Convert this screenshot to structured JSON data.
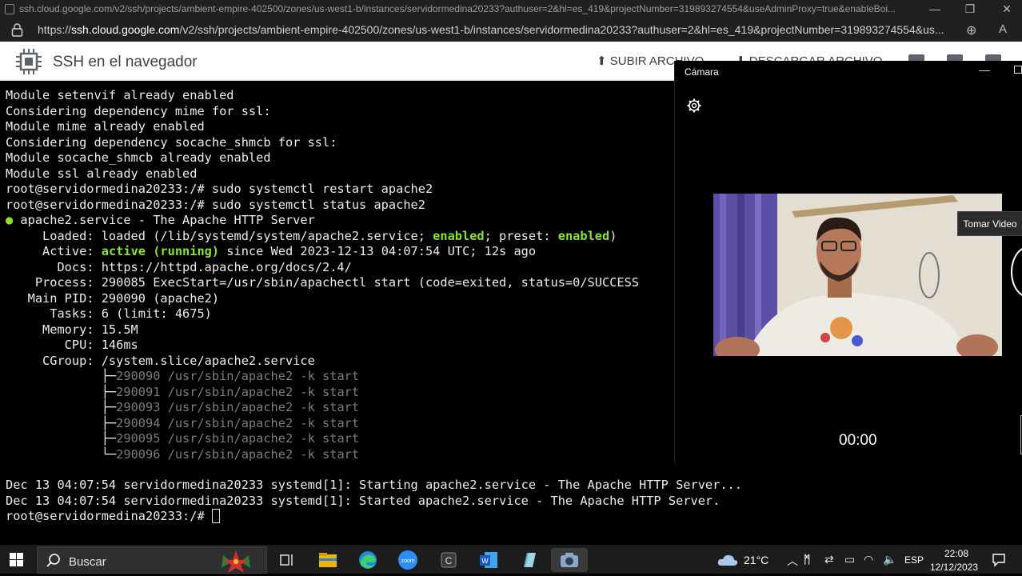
{
  "window": {
    "title": "ssh.cloud.google.com/v2/ssh/projects/ambient-empire-402500/zones/us-west1-b/instances/servidormedina20233?authuser=2&hl=es_419&projectNumber=319893274554&useAdminProxy=true&enableBoi...",
    "minimize": "—",
    "restore": "❐",
    "close": "✕"
  },
  "address_bar": {
    "scheme": "https://",
    "host": "ssh.cloud.google.com",
    "path": "/v2/ssh/projects/ambient-empire-402500/zones/us-west1-b/instances/servidormedina20233?authuser=2&hl=es_419&projectNumber=319893274554&us...",
    "icons": [
      "lock-icon",
      "zoom-icon",
      "read-aloud-icon"
    ]
  },
  "ssh_header": {
    "title": "SSH en el navegador",
    "upload_label": "SUBIR ARCHIVO",
    "download_label": "DESCARGAR ARCHIVO"
  },
  "terminal": {
    "lines": [
      "Module setenvif already enabled",
      "Considering dependency mime for ssl:",
      "Module mime already enabled",
      "Considering dependency socache_shmcb for ssl:",
      "Module socache_shmcb already enabled",
      "Module ssl already enabled",
      "root@servidormedina20233:/# sudo systemctl restart apache2",
      "root@servidormedina20233:/# sudo systemctl status apache2"
    ],
    "status": {
      "bullet": "●",
      "service_line": " apache2.service - The Apache HTTP Server",
      "loaded_prefix": "     Loaded: loaded (/lib/systemd/system/apache2.service; ",
      "loaded_enabled": "enabled",
      "loaded_mid": "; preset: ",
      "loaded_preset": "enabled",
      "loaded_suffix": ")",
      "active_prefix": "     Active: ",
      "active_state": "active (running)",
      "active_suffix": " since Wed 2023-12-13 04:07:54 UTC; 12s ago",
      "docs": "       Docs: https://httpd.apache.org/docs/2.4/",
      "process": "    Process: 290085 ExecStart=/usr/sbin/apachectl start (code=exited, status=0/SUCCESS",
      "main_pid": "   Main PID: 290090 (apache2)",
      "tasks": "      Tasks: 6 (limit: 4675)",
      "memory": "     Memory: 15.5M",
      "cpu": "        CPU: 146ms",
      "cgroup": "     CGroup: /system.slice/apache2.service"
    },
    "processes": [
      {
        "tree": "             ├─",
        "text": "290090 /usr/sbin/apache2 -k start"
      },
      {
        "tree": "             ├─",
        "text": "290091 /usr/sbin/apache2 -k start"
      },
      {
        "tree": "             ├─",
        "text": "290093 /usr/sbin/apache2 -k start"
      },
      {
        "tree": "             ├─",
        "text": "290094 /usr/sbin/apache2 -k start"
      },
      {
        "tree": "             ├─",
        "text": "290095 /usr/sbin/apache2 -k start"
      },
      {
        "tree": "             └─",
        "text": "290096 /usr/sbin/apache2 -k start"
      }
    ],
    "log_lines": [
      "Dec 13 04:07:54 servidormedina20233 systemd[1]: Starting apache2.service - The Apache HTTP Server...",
      "Dec 13 04:07:54 servidormedina20233 systemd[1]: Started apache2.service - The Apache HTTP Server."
    ],
    "prompt": "root@servidormedina20233:/# "
  },
  "camera": {
    "title": "Cámara",
    "tooltip": "Tomar Video",
    "timer": "00:00"
  },
  "taskbar": {
    "search_placeholder": "Buscar",
    "apps": [
      "task-view-icon",
      "file-explorer-icon",
      "edge-icon",
      "zoom-icon",
      "c-app-icon",
      "word-icon",
      "notepad-icon",
      "camera-app-icon"
    ],
    "temperature": "21°C",
    "language": "ESP",
    "time": "22:08",
    "date": "12/12/2023"
  },
  "colors": {
    "terminal_bg": "#000000",
    "terminal_fg": "#ececec",
    "green": "#8ae234",
    "dim": "#7c7c7c",
    "header_bg": "#ffffff",
    "taskbar_bg": "#1c1c1c"
  }
}
